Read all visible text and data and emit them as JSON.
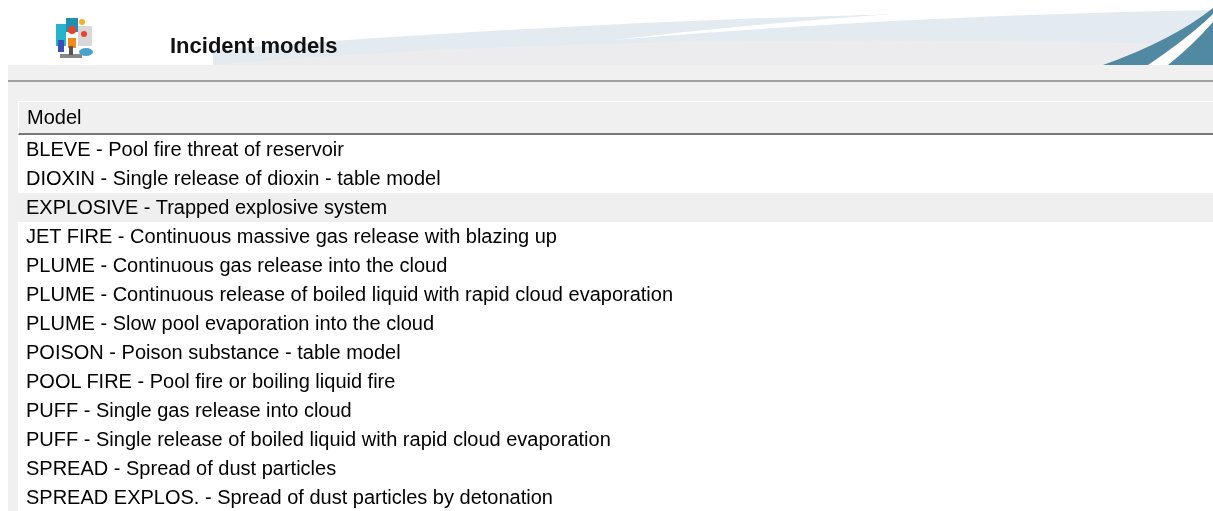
{
  "header": {
    "title": "Incident models"
  },
  "table": {
    "columns": [
      "Model"
    ],
    "rows": [
      {
        "text": "BLEVE - Pool fire threat of reservoir",
        "selected": false
      },
      {
        "text": "DIOXIN - Single release of dioxin - table model",
        "selected": false
      },
      {
        "text": "EXPLOSIVE - Trapped explosive system",
        "selected": true
      },
      {
        "text": "JET FIRE - Continuous massive gas release with blazing up",
        "selected": false
      },
      {
        "text": "PLUME - Continuous gas release into the cloud",
        "selected": false
      },
      {
        "text": "PLUME - Continuous release of boiled liquid with rapid cloud evaporation",
        "selected": false
      },
      {
        "text": "PLUME - Slow pool evaporation into the cloud",
        "selected": false
      },
      {
        "text": "POISON - Poison substance - table model",
        "selected": false
      },
      {
        "text": "POOL FIRE - Pool fire or boiling liquid fire",
        "selected": false
      },
      {
        "text": "PUFF - Single gas release into cloud",
        "selected": false
      },
      {
        "text": "PUFF - Single release of boiled liquid with rapid cloud evaporation",
        "selected": false
      },
      {
        "text": "SPREAD - Spread of dust particles",
        "selected": false
      },
      {
        "text": "SPREAD EXPLOS. - Spread of dust particles by detonation",
        "selected": false
      }
    ]
  }
}
